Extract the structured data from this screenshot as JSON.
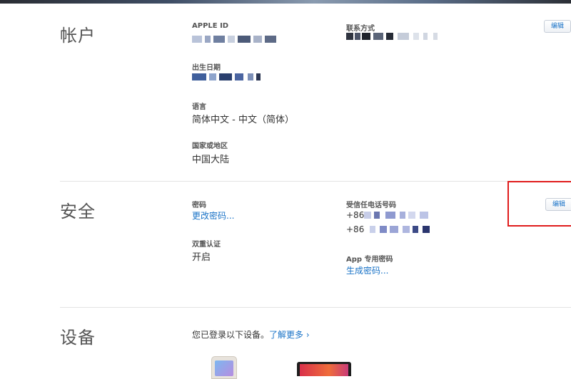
{
  "colors": {
    "link": "#1a73c7",
    "highlight": "#e01b1b",
    "divider": "#e3e3e3"
  },
  "account": {
    "title": "帐户",
    "edit_label": "编辑",
    "apple_id_label": "APPLE ID",
    "contact_label": "联系方式",
    "birthday_label": "出生日期",
    "language_label": "语言",
    "language_value": "简体中文 - 中文（简体）",
    "region_label": "国家或地区",
    "region_value": "中国大陆"
  },
  "security": {
    "title": "安全",
    "edit_label": "编辑",
    "password_label": "密码",
    "change_password_link": "更改密码...",
    "two_factor_label": "双重认证",
    "two_factor_value": "开启",
    "trusted_phone_label": "受信任电话号码",
    "phone_prefix_1": "+86",
    "phone_prefix_2": "+86",
    "app_password_label": "App 专用密码",
    "generate_password_link": "生成密码..."
  },
  "devices": {
    "title": "设备",
    "description": "您已登录以下设备。",
    "learn_more_link": "了解更多 ›",
    "items": [
      {
        "icon": "iphone-icon"
      },
      {
        "icon": "macbook-icon"
      }
    ]
  }
}
